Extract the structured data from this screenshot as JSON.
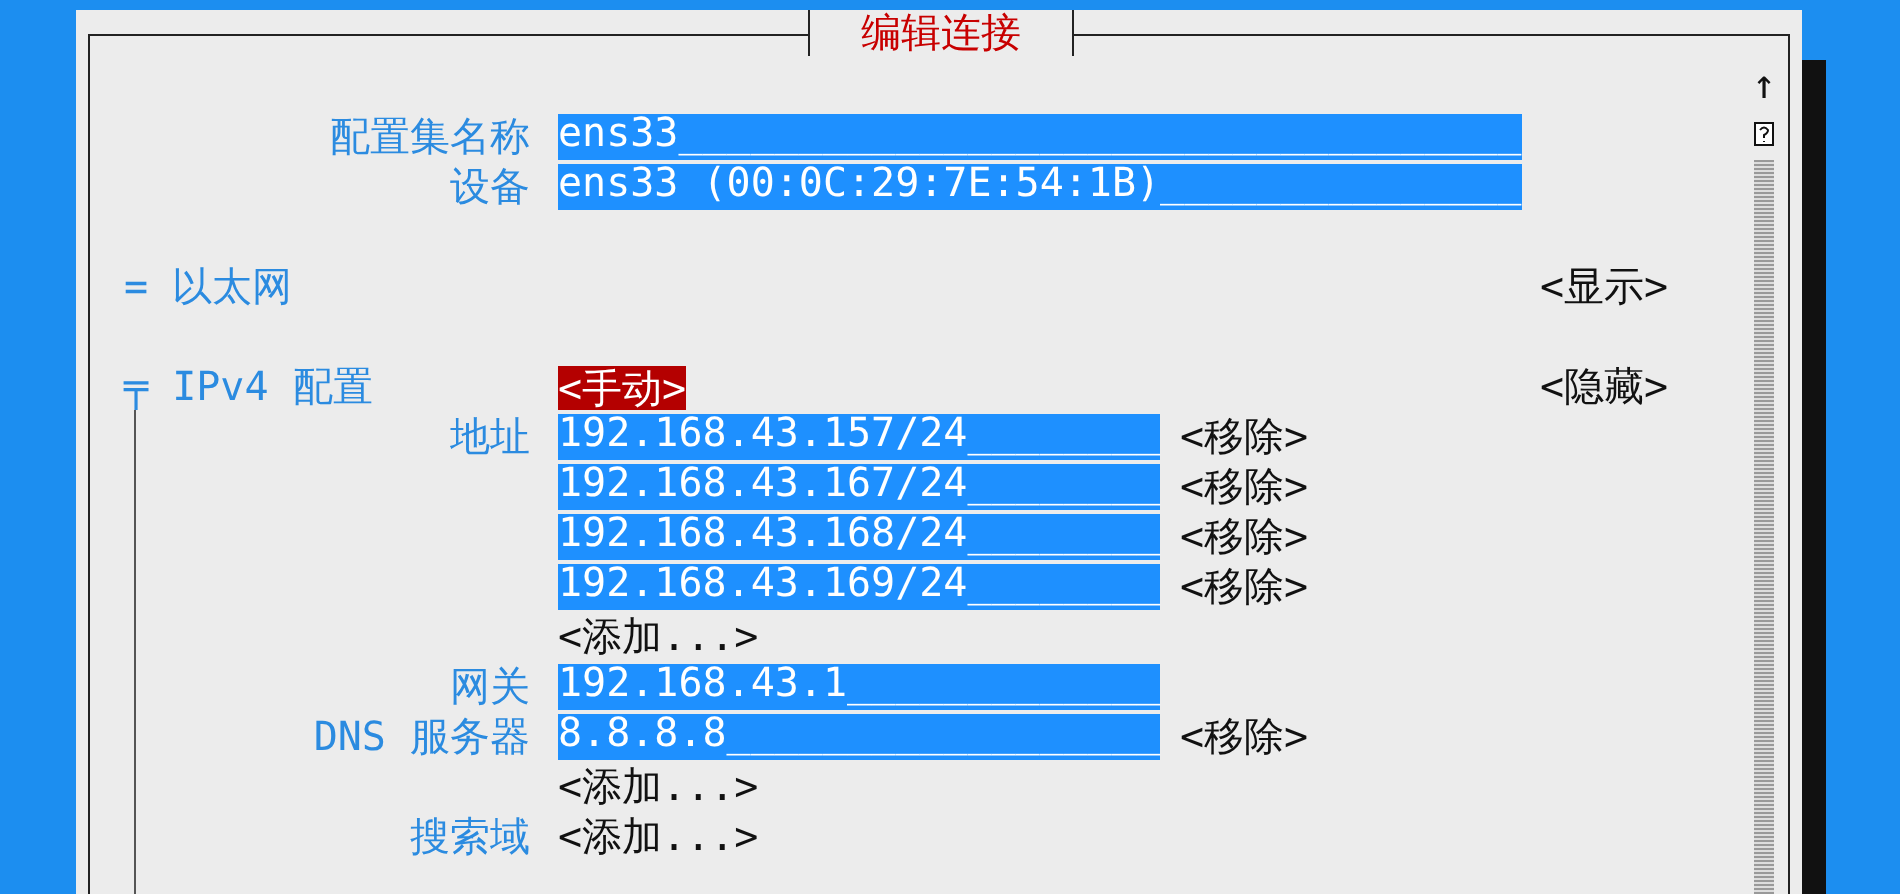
{
  "dialog": {
    "title": "编辑连接"
  },
  "fields": [
    {
      "label": "配置集名称",
      "value": "ens33___________________________________"
    },
    {
      "label": "设备",
      "value": "ens33 (00:0C:29:7E:54:1B)_______________"
    }
  ],
  "sections": [
    {
      "toggle": "=",
      "title": "以太网",
      "expanded": false,
      "button": "<显示>"
    },
    {
      "toggle": "╤",
      "title": "IPv4 配置",
      "expanded": true,
      "mode": "<手动>",
      "button": "<隐藏>",
      "groups": [
        {
          "label": "地址",
          "entries": [
            {
              "value": "192.168.43.157/24________",
              "remove": "<移除>"
            },
            {
              "value": "192.168.43.167/24________",
              "remove": "<移除>"
            },
            {
              "value": "192.168.43.168/24________",
              "remove": "<移除>"
            },
            {
              "value": "192.168.43.169/24________",
              "remove": "<移除>"
            }
          ],
          "add": "<添加...>"
        },
        {
          "label": "网关",
          "entries": [
            {
              "value": "192.168.43.1_____________"
            }
          ]
        },
        {
          "label": "DNS 服务器",
          "entries": [
            {
              "value": "8.8.8.8__________________",
              "remove": "<移除>"
            }
          ],
          "add": "<添加...>"
        },
        {
          "label": "搜索域",
          "add": "<添加...>"
        }
      ]
    }
  ],
  "scrollbar": {
    "up": "↑"
  }
}
